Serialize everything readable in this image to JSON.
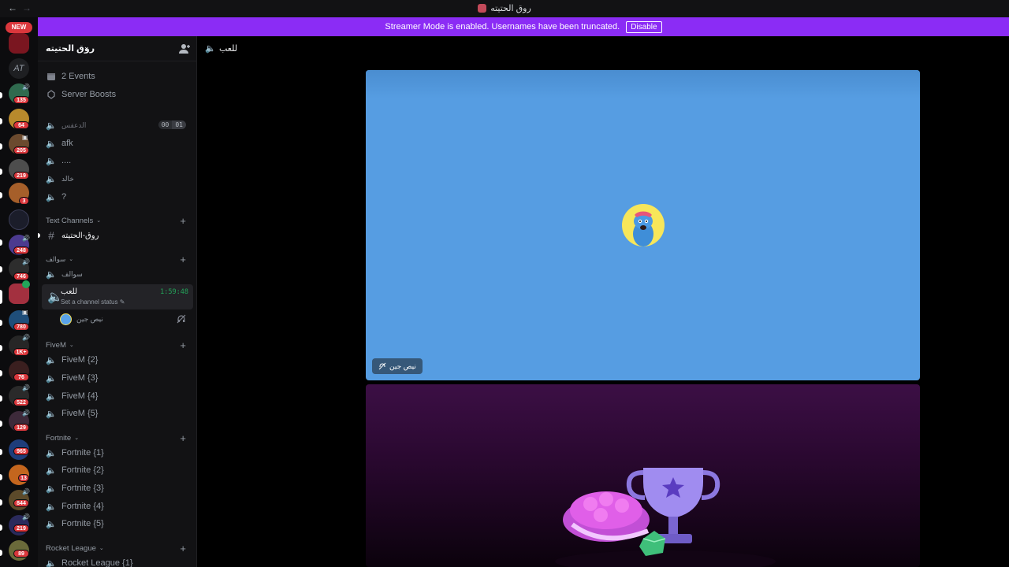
{
  "titlebar": {
    "back": "←",
    "forward": "→",
    "title": "روق الحتيته"
  },
  "banner": {
    "message": "Streamer Mode is enabled. Usernames have been truncated.",
    "disable_label": "Disable"
  },
  "server_list": {
    "new_label": "NEW",
    "badges": [
      "135",
      "64",
      "205",
      "219",
      "3",
      "248",
      "746",
      "780",
      "1K+",
      "76",
      "522",
      "129",
      "965",
      "13",
      "844",
      "219",
      "89"
    ]
  },
  "guild": {
    "name": "روق الحتيته",
    "events_label": "2 Events",
    "boosts_label": "Server Boosts"
  },
  "voice_channels_top": [
    {
      "label": "الدعقس"
    },
    {
      "label": "afk"
    },
    {
      "label": "...."
    },
    {
      "label": "خالد"
    },
    {
      "label": "?"
    }
  ],
  "counter": {
    "a": "00",
    "b": "01"
  },
  "categories": {
    "text": "Text Channels",
    "sawalif": "سوالف",
    "fivem": "FiveM",
    "fortnite": "Fortnite",
    "rocket": "Rocket League"
  },
  "text_channel": {
    "label": "روق-الحتيته"
  },
  "sawalif_channel": {
    "label": "سوالف"
  },
  "active_channel": {
    "name": "للعب",
    "status": "Set a channel status",
    "timer": "1:59:48"
  },
  "voice_user": {
    "name": "نيص جين"
  },
  "fivem_channels": [
    "FiveM {2}",
    "FiveM {3}",
    "FiveM {4}",
    "FiveM {5}"
  ],
  "fortnite_channels": [
    "Fortnite {1}",
    "Fortnite {2}",
    "Fortnite {3}",
    "Fortnite {4}",
    "Fortnite {5}"
  ],
  "rocket_channels": [
    "Rocket League {1}"
  ],
  "main": {
    "channel_title": "للعب",
    "tile_user": "نيص جين"
  },
  "colors": {
    "banner": "#8b2cf5",
    "tile_blue": "#569de2",
    "speaking_green": "#23a55a",
    "badge_red": "#da373c"
  }
}
